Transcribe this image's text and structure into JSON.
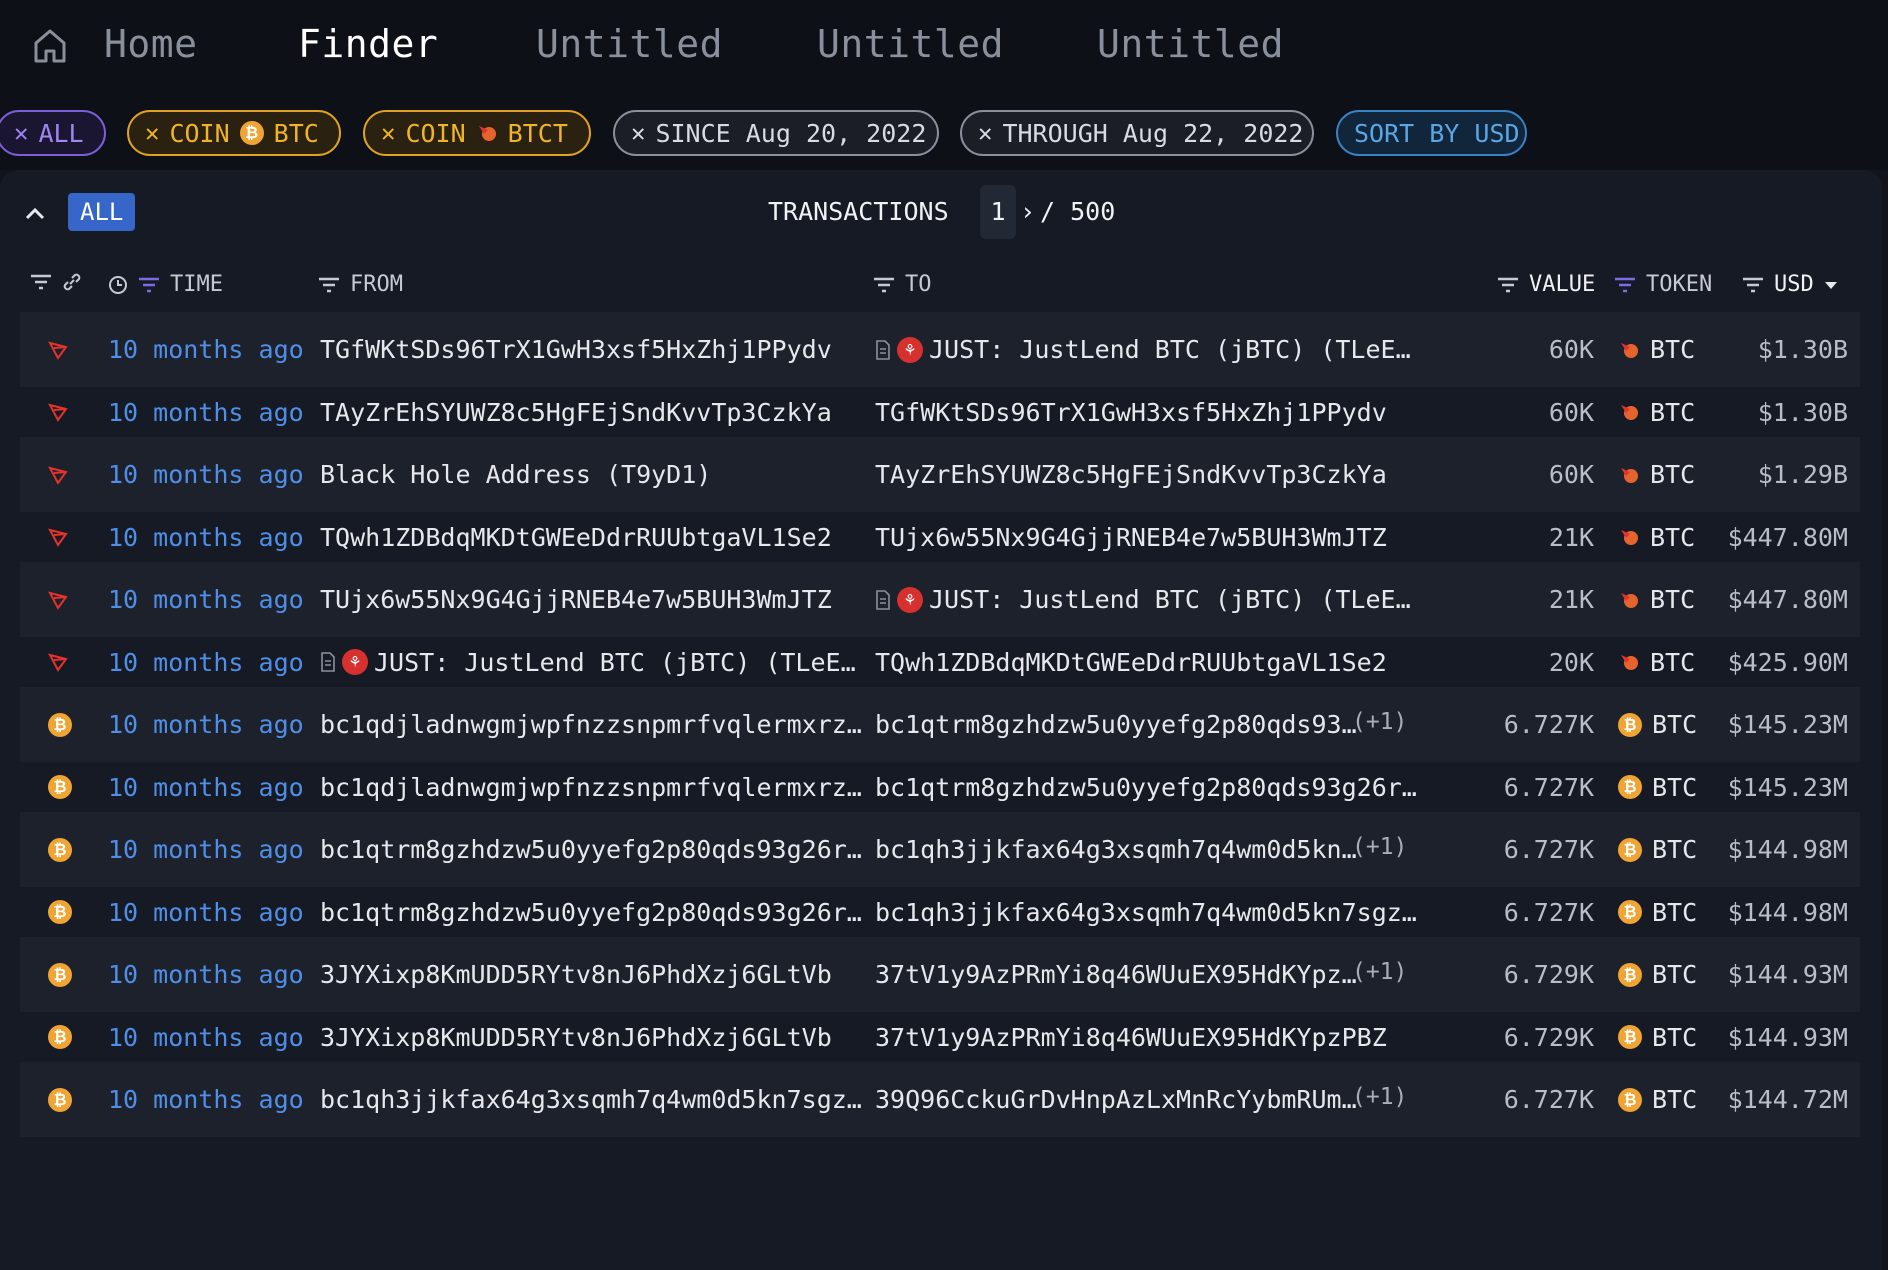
{
  "nav": {
    "tabs": [
      {
        "label": "Home"
      },
      {
        "label": "Finder"
      },
      {
        "label": "Untitled"
      },
      {
        "label": "Untitled"
      },
      {
        "label": "Untitled"
      }
    ]
  },
  "filters": {
    "all": "ALL",
    "coin1_key": "COIN",
    "coin1_val": "BTC",
    "coin2_key": "COIN",
    "coin2_val": "BTCT",
    "since": "SINCE Aug 20, 2022",
    "through": "THROUGH Aug 22, 2022",
    "sort": "SORT BY USD"
  },
  "panel": {
    "all_badge": "ALL",
    "title": "TRANSACTIONS",
    "page": "1",
    "page_next": "›",
    "page_total": "/ 500"
  },
  "columns": {
    "time": "TIME",
    "from": "FROM",
    "to": "TO",
    "value": "VALUE",
    "token": "TOKEN",
    "usd": "USD"
  },
  "colors": {
    "tron": "#e5322d",
    "btc": "#f0a434",
    "link": "#4f8fe8",
    "accent_blue": "#3566c8"
  },
  "rows": [
    {
      "chain": "tron",
      "time": "10 months ago",
      "from": "TGfWKtSDs96TrX1GwH3xsf5HxZhj1PPydv",
      "from_entity": false,
      "to": "JUST: JustLend BTC (jBTC) (TLeE…",
      "to_entity": true,
      "extra": "",
      "value": "60K",
      "token_icon": "btct",
      "token": "BTC",
      "usd": "$1.30B"
    },
    {
      "chain": "tron",
      "time": "10 months ago",
      "from": "TAyZrEhSYUWZ8c5HgFEjSndKvvTp3CzkYa",
      "from_entity": false,
      "to": "TGfWKtSDs96TrX1GwH3xsf5HxZhj1PPydv",
      "to_entity": false,
      "extra": "",
      "value": "60K",
      "token_icon": "btct",
      "token": "BTC",
      "usd": "$1.30B"
    },
    {
      "chain": "tron",
      "time": "10 months ago",
      "from": "Black Hole Address (T9yD1)",
      "from_entity": false,
      "to": "TAyZrEhSYUWZ8c5HgFEjSndKvvTp3CzkYa",
      "to_entity": false,
      "extra": "",
      "value": "60K",
      "token_icon": "btct",
      "token": "BTC",
      "usd": "$1.29B"
    },
    {
      "chain": "tron",
      "time": "10 months ago",
      "from": "TQwh1ZDBdqMKDtGWEeDdrRUUbtgaVL1Se2",
      "from_entity": false,
      "to": "TUjx6w55Nx9G4GjjRNEB4e7w5BUH3WmJTZ",
      "to_entity": false,
      "extra": "",
      "value": "21K",
      "token_icon": "btct",
      "token": "BTC",
      "usd": "$447.80M"
    },
    {
      "chain": "tron",
      "time": "10 months ago",
      "from": "TUjx6w55Nx9G4GjjRNEB4e7w5BUH3WmJTZ",
      "from_entity": false,
      "to": "JUST: JustLend BTC (jBTC) (TLeE…",
      "to_entity": true,
      "extra": "",
      "value": "21K",
      "token_icon": "btct",
      "token": "BTC",
      "usd": "$447.80M"
    },
    {
      "chain": "tron",
      "time": "10 months ago",
      "from": "JUST: JustLend BTC (jBTC) (TLeE…",
      "from_entity": true,
      "to": "TQwh1ZDBdqMKDtGWEeDdrRUUbtgaVL1Se2",
      "to_entity": false,
      "extra": "",
      "value": "20K",
      "token_icon": "btct",
      "token": "BTC",
      "usd": "$425.90M"
    },
    {
      "chain": "btc",
      "time": "10 months ago",
      "from": "bc1qdjladnwgmjwpfnzzsnpmrfvqlermxrz…",
      "from_entity": false,
      "to": "bc1qtrm8gzhdzw5u0yyefg2p80qds93…",
      "to_entity": false,
      "extra": "(+1)",
      "value": "6.727K",
      "token_icon": "btc",
      "token": "BTC",
      "usd": "$145.23M"
    },
    {
      "chain": "btc",
      "time": "10 months ago",
      "from": "bc1qdjladnwgmjwpfnzzsnpmrfvqlermxrz…",
      "from_entity": false,
      "to": "bc1qtrm8gzhdzw5u0yyefg2p80qds93g26r…",
      "to_entity": false,
      "extra": "",
      "value": "6.727K",
      "token_icon": "btc",
      "token": "BTC",
      "usd": "$145.23M"
    },
    {
      "chain": "btc",
      "time": "10 months ago",
      "from": "bc1qtrm8gzhdzw5u0yyefg2p80qds93g26r…",
      "from_entity": false,
      "to": "bc1qh3jjkfax64g3xsqmh7q4wm0d5kn…",
      "to_entity": false,
      "extra": "(+1)",
      "value": "6.727K",
      "token_icon": "btc",
      "token": "BTC",
      "usd": "$144.98M"
    },
    {
      "chain": "btc",
      "time": "10 months ago",
      "from": "bc1qtrm8gzhdzw5u0yyefg2p80qds93g26r…",
      "from_entity": false,
      "to": "bc1qh3jjkfax64g3xsqmh7q4wm0d5kn7sgz…",
      "to_entity": false,
      "extra": "",
      "value": "6.727K",
      "token_icon": "btc",
      "token": "BTC",
      "usd": "$144.98M"
    },
    {
      "chain": "btc",
      "time": "10 months ago",
      "from": "3JYXixp8KmUDD5RYtv8nJ6PhdXzj6GLtVb",
      "from_entity": false,
      "to": "37tV1y9AzPRmYi8q46WUuEX95HdKYpz…",
      "to_entity": false,
      "extra": "(+1)",
      "value": "6.729K",
      "token_icon": "btc",
      "token": "BTC",
      "usd": "$144.93M"
    },
    {
      "chain": "btc",
      "time": "10 months ago",
      "from": "3JYXixp8KmUDD5RYtv8nJ6PhdXzj6GLtVb",
      "from_entity": false,
      "to": "37tV1y9AzPRmYi8q46WUuEX95HdKYpzPBZ",
      "to_entity": false,
      "extra": "",
      "value": "6.729K",
      "token_icon": "btc",
      "token": "BTC",
      "usd": "$144.93M"
    },
    {
      "chain": "btc",
      "time": "10 months ago",
      "from": "bc1qh3jjkfax64g3xsqmh7q4wm0d5kn7sgz…",
      "from_entity": false,
      "to": "39Q96CckuGrDvHnpAzLxMnRcYybmRUm…",
      "to_entity": false,
      "extra": "(+1)",
      "value": "6.727K",
      "token_icon": "btc",
      "token": "BTC",
      "usd": "$144.72M"
    }
  ]
}
